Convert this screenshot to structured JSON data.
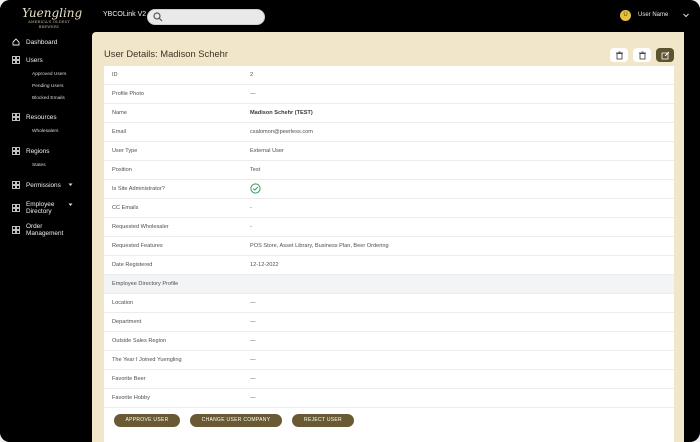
{
  "brand": {
    "logo_text": "Yuengling",
    "logo_tagline": "AMERICA'S OLDEST BREWERY"
  },
  "header": {
    "app_name": "YBCOLink V2",
    "search_placeholder": "",
    "avatar_initial": "U",
    "user_name": "User Name"
  },
  "sidebar": {
    "items": [
      {
        "label": "Dashboard"
      },
      {
        "label": "Users",
        "sub": [
          "Approved Users",
          "Pending Users",
          "Blocked Emails"
        ]
      },
      {
        "label": "Resources",
        "sub": [
          "Wholesalers"
        ]
      },
      {
        "label": "Regions",
        "sub": [
          "States"
        ]
      },
      {
        "label": "Permissions"
      },
      {
        "label": "Employee Directory"
      },
      {
        "label": "Order Management"
      }
    ]
  },
  "page": {
    "title": "User Details: Madison Schehr"
  },
  "details": [
    {
      "key": "ID",
      "value": "2"
    },
    {
      "key": "Profile Photo",
      "value": "—"
    },
    {
      "key": "Name",
      "value": "Madison Schehr (TEST)"
    },
    {
      "key": "Email",
      "value": "csalomon@peerless.com"
    },
    {
      "key": "User Type",
      "value": "External User"
    },
    {
      "key": "Position",
      "value": "Test"
    },
    {
      "key": "Is Site Administrator?",
      "value": ""
    },
    {
      "key": "CC Emails",
      "value": "-"
    },
    {
      "key": "Requested Wholesaler",
      "value": "-"
    },
    {
      "key": "Requested Features",
      "value": "POS Store, Asset Library, Business Plan, Beer Ordering"
    },
    {
      "key": "Date Registered",
      "value": "12-12-2022"
    },
    {
      "key": "Employee Directory Profile",
      "value": ""
    },
    {
      "key": "Location",
      "value": "—"
    },
    {
      "key": "Department",
      "value": "—"
    },
    {
      "key": "Outside Sales Region",
      "value": "—"
    },
    {
      "key": "The Year I Joined Yuengling",
      "value": "—"
    },
    {
      "key": "Favorite Beer",
      "value": "—"
    },
    {
      "key": "Favorite Hobby",
      "value": "—"
    }
  ],
  "actions": {
    "approve": "APPROVE USER",
    "change_company": "CHANGE USER COMPANY",
    "reject": "REJECT USER"
  },
  "colors": {
    "accent": "#6a5a34",
    "panel_bg": "#f1e6c9",
    "sidebar_bg": "#000000",
    "success": "#2e9e5b"
  }
}
